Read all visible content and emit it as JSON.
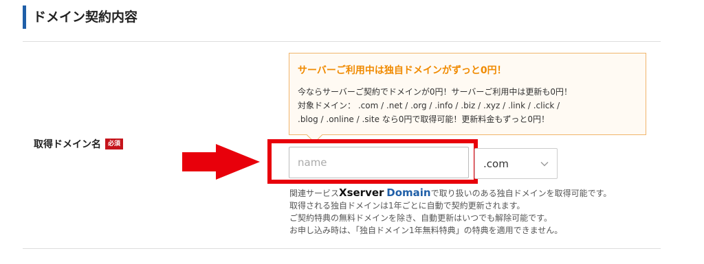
{
  "section": {
    "title": "ドメイン契約内容"
  },
  "form": {
    "label": "取得ドメイン名",
    "required_badge": "必須",
    "domain_input": {
      "value": "",
      "placeholder": "name"
    },
    "tld_select": {
      "selected": ".com"
    }
  },
  "promo": {
    "title": "サーバーご利用中は独自ドメインがずっと0円！",
    "lines": [
      "今ならサーバーご契約でドメインが0円！サーバーご利用中は更新も0円！",
      "対象ドメイン： .com / .net / .org / .info / .biz / .xyz / .link / .click /",
      ".blog / .online / .site なら0円で取得可能！更新料金もずっと0円！"
    ]
  },
  "notes": {
    "line1_prefix": "関連サービス",
    "brand_part1": "Xserver",
    "brand_part2": "Domain",
    "line1_suffix": "で取り扱いのある独自ドメインを取得可能です。",
    "line2": "取得される独自ドメインは1年ごとに自動で契約更新されます。",
    "line3": "ご契約特典の無料ドメインを除き、自動更新はいつでも解除可能です。",
    "line4": "お申し込み時は、「独自ドメイン1年無料特典」の特典を適用できません。"
  },
  "colors": {
    "accent_bar": "#1f5fa8",
    "promo_title": "#f08a00",
    "required": "#c5141b",
    "highlight": "#e8000b"
  },
  "icons": {
    "arrow": "red-arrow-right-icon",
    "select": "chevron-down-icon"
  }
}
